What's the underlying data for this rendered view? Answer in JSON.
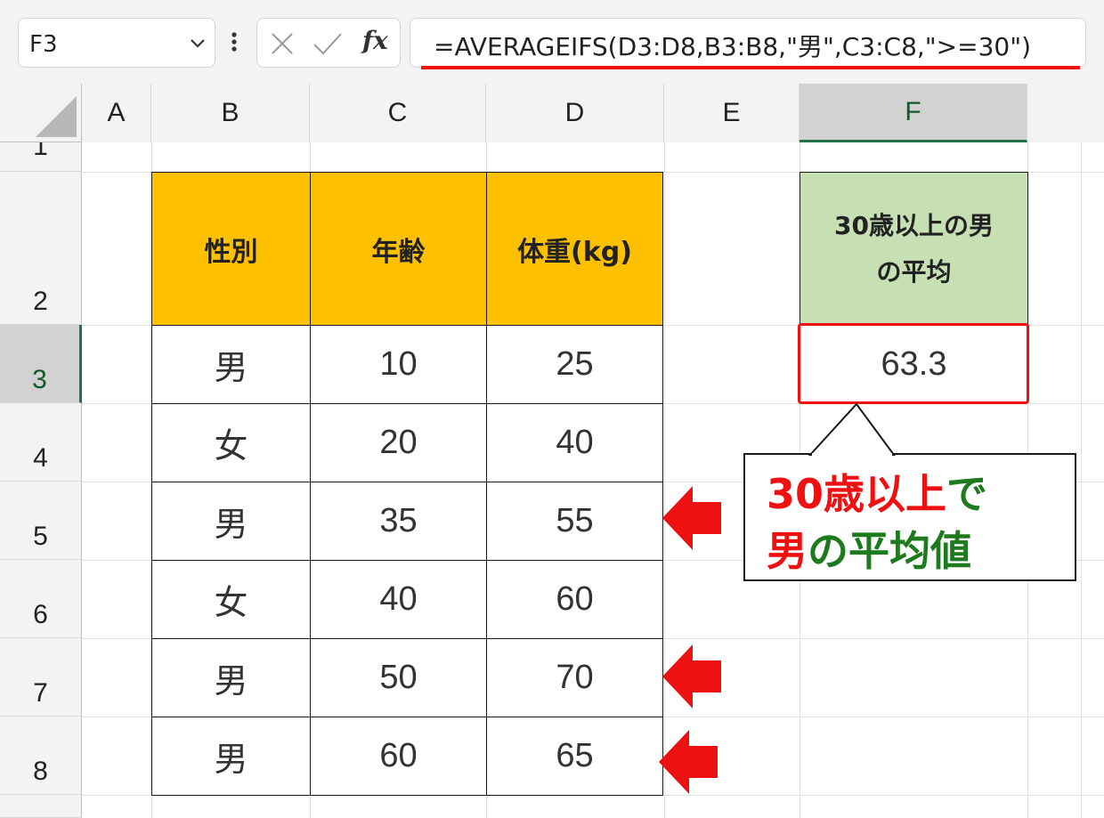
{
  "formula_bar": {
    "name_box": "F3",
    "fx_label": "fx",
    "formula": "=AVERAGEIFS(D3:D8,B3:B8,\"男\",C3:C8,\">=30\")"
  },
  "columns": [
    "A",
    "B",
    "C",
    "D",
    "E",
    "F"
  ],
  "rows": [
    "1",
    "2",
    "3",
    "4",
    "5",
    "6",
    "7",
    "8"
  ],
  "table": {
    "headers": [
      "性別",
      "年齢",
      "体重(kg)"
    ],
    "rows": [
      [
        "男",
        "10",
        "25"
      ],
      [
        "女",
        "20",
        "40"
      ],
      [
        "男",
        "35",
        "55"
      ],
      [
        "女",
        "40",
        "60"
      ],
      [
        "男",
        "50",
        "70"
      ],
      [
        "男",
        "60",
        "65"
      ]
    ]
  },
  "result": {
    "header_line1": "30歳以上の男",
    "header_line2": "の平均",
    "value": "63.3"
  },
  "callout": {
    "line1_red": "30歳以上",
    "line1_green": "で",
    "line2_red": "男",
    "line2_green": "の平均値"
  },
  "colors": {
    "header_fill": "#ffc000",
    "result_header_fill": "#c6e0b4",
    "highlight_red": "#ee1111",
    "callout_green": "#1e7a1e",
    "selection_green": "#217346"
  },
  "icons": [
    "chevron-down-icon",
    "more-vertical-icon",
    "cancel-icon",
    "enter-check-icon",
    "insert-function-icon",
    "select-all-triangle-icon",
    "arrow-left-icon"
  ]
}
